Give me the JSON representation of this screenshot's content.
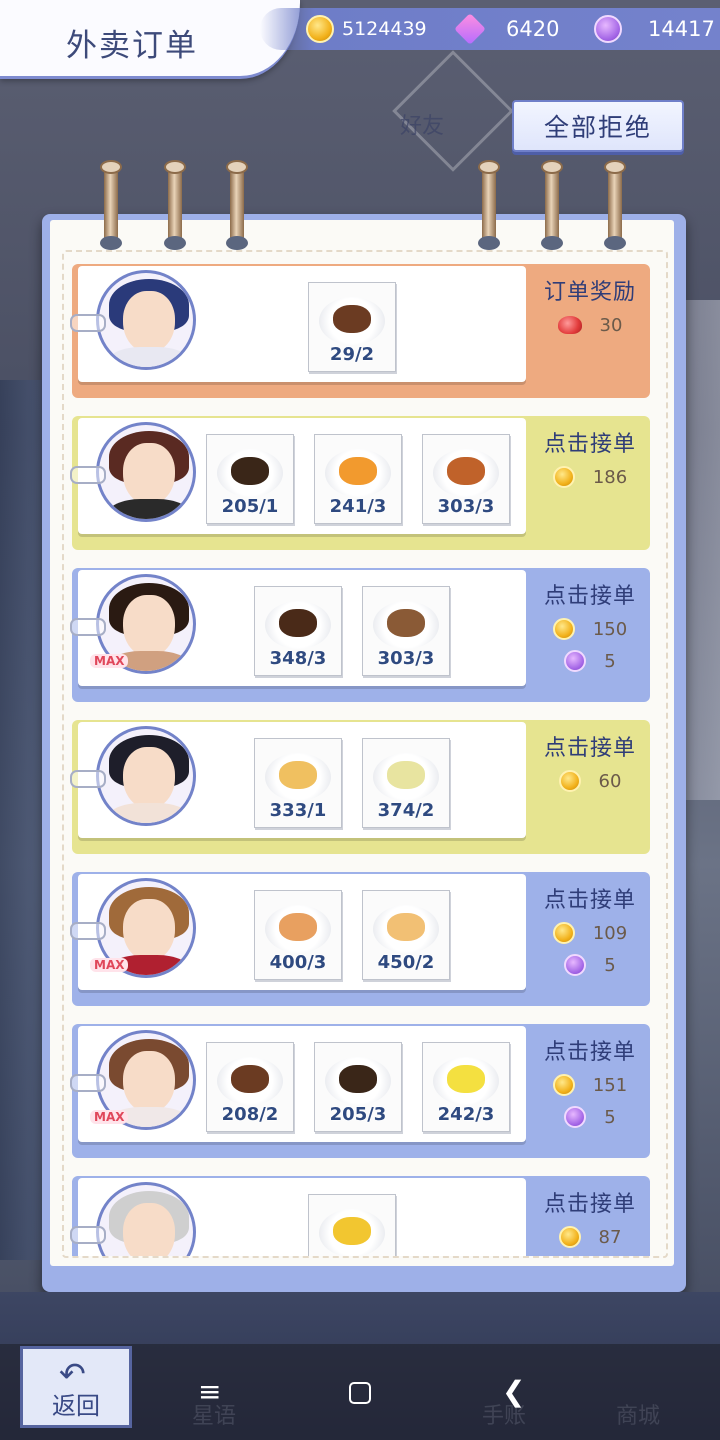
{
  "header": {
    "title": "外卖订单",
    "coins": "5124439",
    "gems": "6420",
    "hearts": "14417",
    "reject_all": "全部拒绝",
    "friends_label": "好友"
  },
  "orders": [
    {
      "status": "订单奖励",
      "theme": "orange",
      "dishes": [
        {
          "count": "29/2",
          "food": "coffee-latte"
        }
      ],
      "rewards": [
        {
          "icon": "ruby-icon",
          "value": "30"
        }
      ]
    },
    {
      "status": "点击接单",
      "theme": "yellow",
      "dishes": [
        {
          "count": "205/1",
          "food": "cake-slice"
        },
        {
          "count": "241/3",
          "food": "orange-dessert"
        },
        {
          "count": "303/3",
          "food": "fried-balls"
        }
      ],
      "rewards": [
        {
          "icon": "coin-icon",
          "value": "186"
        }
      ]
    },
    {
      "status": "点击接单",
      "theme": "blue",
      "max": "MAX",
      "dishes": [
        {
          "count": "348/3",
          "food": "coffee-cup"
        },
        {
          "count": "303/3",
          "food": "ice-cream"
        }
      ],
      "rewards": [
        {
          "icon": "coin-icon",
          "value": "150"
        },
        {
          "icon": "heart-icon",
          "value": "5"
        }
      ]
    },
    {
      "status": "点击接单",
      "theme": "yellow",
      "dishes": [
        {
          "count": "333/1",
          "food": "pancake"
        },
        {
          "count": "374/2",
          "food": "soup"
        }
      ],
      "rewards": [
        {
          "icon": "coin-icon",
          "value": "60"
        }
      ]
    },
    {
      "status": "点击接单",
      "theme": "blue",
      "max": "MAX",
      "dishes": [
        {
          "count": "400/3",
          "food": "spaghetti"
        },
        {
          "count": "450/2",
          "food": "pizza-slice"
        }
      ],
      "rewards": [
        {
          "icon": "coin-icon",
          "value": "109"
        },
        {
          "icon": "heart-icon",
          "value": "5"
        }
      ]
    },
    {
      "status": "点击接单",
      "theme": "blue",
      "max": "MAX",
      "dishes": [
        {
          "count": "208/2",
          "food": "coffee-latte"
        },
        {
          "count": "205/3",
          "food": "cake-slice"
        },
        {
          "count": "242/3",
          "food": "egg-dish"
        }
      ],
      "rewards": [
        {
          "icon": "coin-icon",
          "value": "151"
        },
        {
          "icon": "heart-icon",
          "value": "5"
        }
      ]
    },
    {
      "status": "点击接单",
      "theme": "blue",
      "dishes": [
        {
          "count": "",
          "food": "butter-toast"
        }
      ],
      "rewards": [
        {
          "icon": "coin-icon",
          "value": "87"
        }
      ]
    }
  ],
  "bottom": {
    "back_label": "返回",
    "nav_ghost_1": "星语",
    "nav_ghost_2": "手账",
    "nav_ghost_3": "商城"
  },
  "colors": {
    "orange": "#eeaa80",
    "yellow": "#e6e490",
    "blue": "#9eb1e9",
    "accent": "#7482cc"
  }
}
